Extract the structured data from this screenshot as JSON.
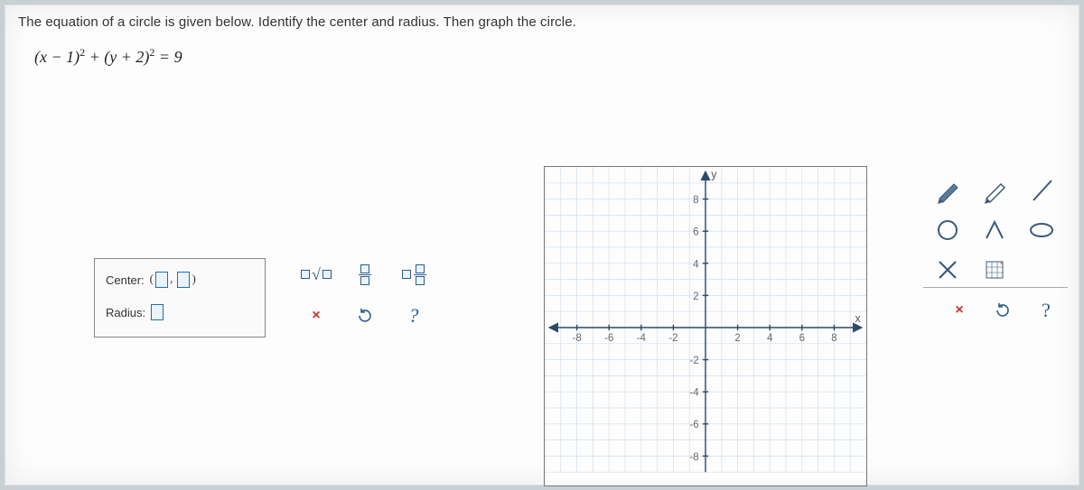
{
  "problem": {
    "instruction": "The equation of a circle is given below. Identify the center and radius. Then graph the circle.",
    "equation_display": "(x − 1)² + (y + 2)² = 9"
  },
  "inputs": {
    "center_label": "Center:",
    "radius_label": "Radius:"
  },
  "math_tools": {
    "sqrt": "□√□",
    "frac": "□/□",
    "mixed": "□ □/□",
    "clear": "×",
    "redo": "↻",
    "help": "?"
  },
  "graph": {
    "x_label": "x",
    "y_label": "y",
    "x_range": [
      -10,
      10
    ],
    "y_range": [
      -10,
      10
    ],
    "visible_y_lo": -9,
    "x_ticks": [
      -8,
      -6,
      -4,
      -2,
      2,
      4,
      6,
      8
    ],
    "y_ticks": [
      -8,
      -6,
      -4,
      -2,
      2,
      4,
      6,
      8
    ]
  },
  "draw_tools": {
    "pencil_fill": "pencil-fill",
    "pencil_line": "pencil-line",
    "line": "line",
    "circle_open": "circle-open",
    "angle": "angle",
    "ellipse": "ellipse",
    "x_mark": "x-mark",
    "grid_target": "grid-target"
  },
  "lower_tools": {
    "clear": "×",
    "redo": "↻",
    "help": "?"
  }
}
